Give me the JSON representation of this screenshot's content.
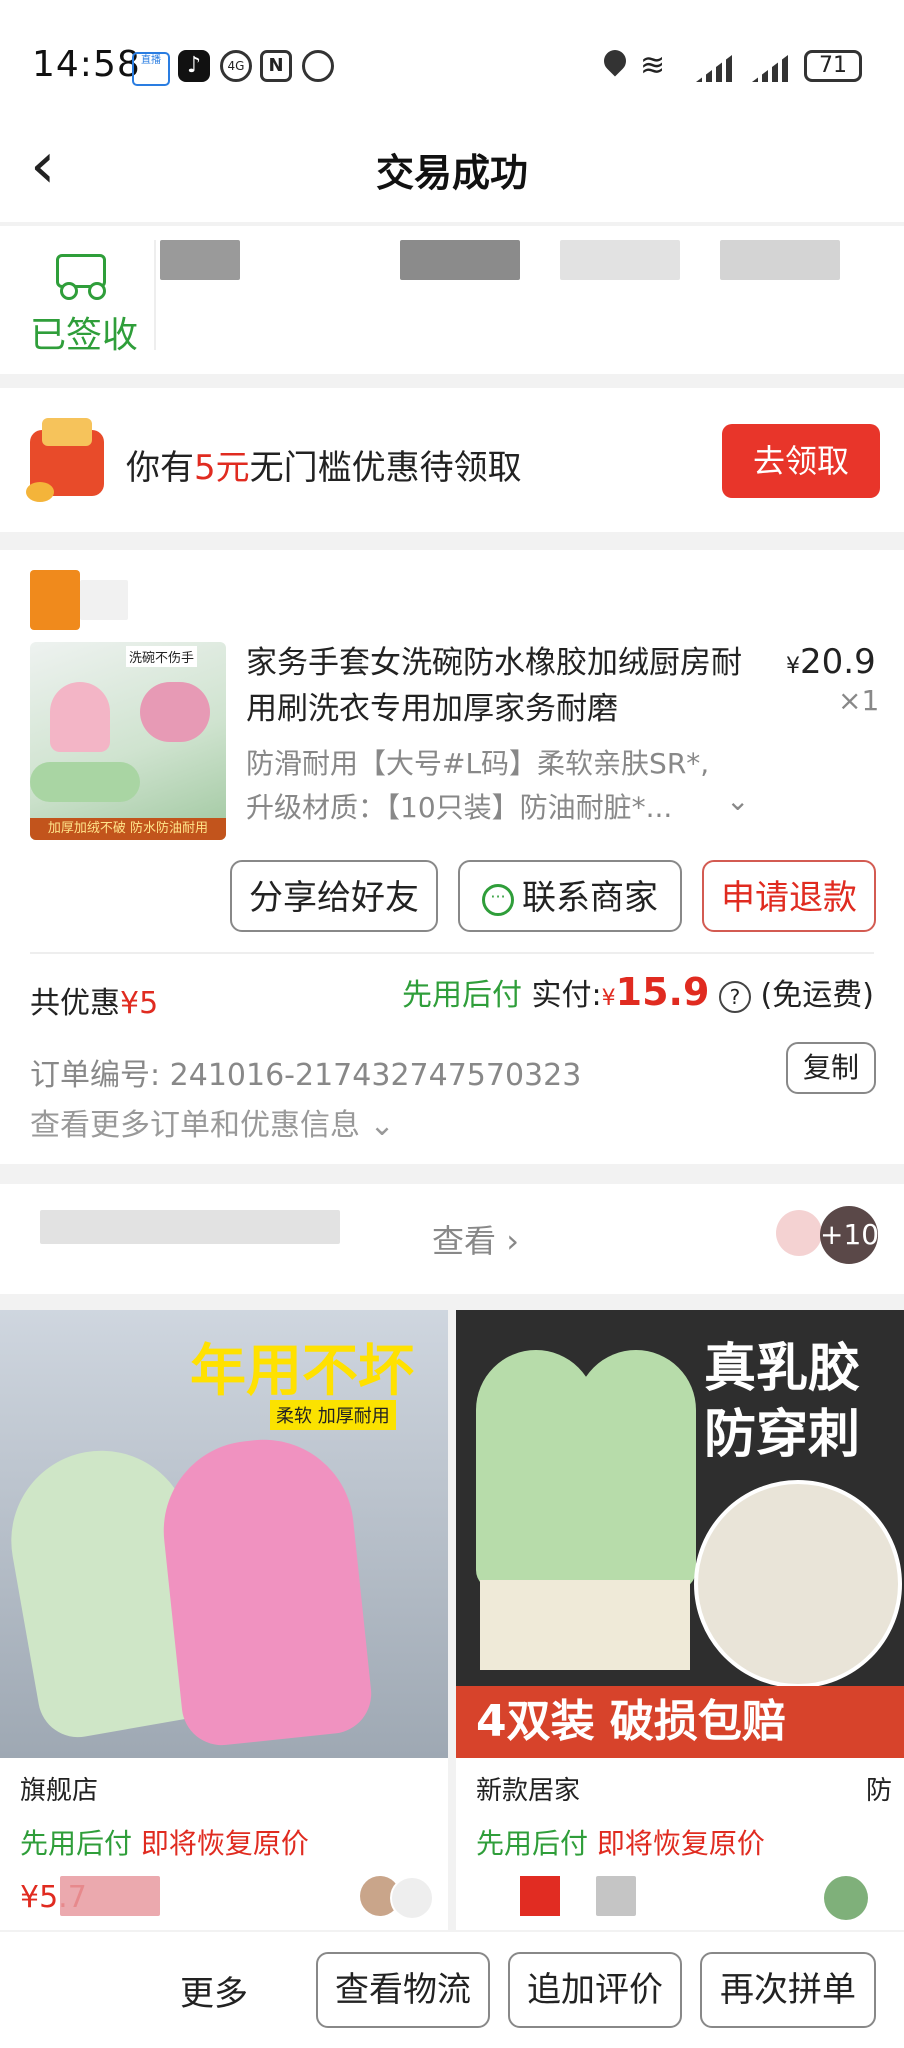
{
  "status": {
    "time": "14:58",
    "battery": "71",
    "badge": "直播"
  },
  "header": {
    "title": "交易成功",
    "back_icon": "chevron-left-icon"
  },
  "delivery": {
    "status": "已签收",
    "truck_icon": "truck-icon"
  },
  "coupon": {
    "prefix": "你有",
    "amount": "5元",
    "suffix": "无门槛优惠待领取",
    "button": "去领取"
  },
  "product": {
    "title": "家务手套女洗碗防水橡胶加绒厨房耐用刷洗衣专用加厚家务耐磨",
    "price_symbol": "¥",
    "price": "20.9",
    "qty": "×1",
    "spec_line1": "防滑耐用【大号#L码】柔软亲肤SR*,",
    "spec_line2": "升级材质：【10只装】防油耐脏*...",
    "thumb_banner_top": "洗碗不伤手",
    "thumb_banner_bottom": "加厚加绒不破 防水防油耐用"
  },
  "actions": {
    "share": "分享给好友",
    "contact": "联系商家",
    "refund": "申请退款"
  },
  "summary": {
    "discount_label": "共优惠",
    "discount_value": "¥5",
    "pay_later": "先用后付",
    "paid_label": "实付:",
    "paid_symbol": "¥",
    "paid_value": "15.9",
    "help": "?",
    "shipping": "(免运费)"
  },
  "order": {
    "label": "订单编号:",
    "number": "241016-217432747570323",
    "copy": "复制",
    "more": "查看更多订单和优惠信息"
  },
  "recommend": {
    "see": "查看",
    "avatar_count": "+10"
  },
  "products": [
    {
      "img_text1": "年用不坏",
      "img_text2": "柔软 加厚耐用",
      "name": "旗舰店",
      "pay_later": "先用后付",
      "restore": "即将恢复原价",
      "price": "¥5.7"
    },
    {
      "img_text1": "真乳胶",
      "img_text2": "防穿刺",
      "img_text3": "4双装  破损包赔",
      "name": "新款居家",
      "name_tail": "防",
      "pay_later": "先用后付",
      "restore": "即将恢复原价",
      "price": ""
    }
  ],
  "bottom": {
    "more": "更多",
    "logistics": "查看物流",
    "review": "追加评价",
    "rebuy": "再次拼单"
  }
}
